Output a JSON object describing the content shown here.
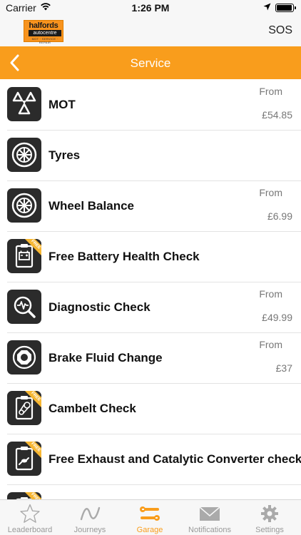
{
  "status": {
    "carrier": "Carrier",
    "time": "1:26 PM"
  },
  "header": {
    "logo": {
      "line1": "halfords",
      "line2": "autocentre",
      "line3": "MOT · SERVICE · REPAIR"
    },
    "sos_label": "SOS"
  },
  "nav": {
    "title": "Service"
  },
  "services": [
    {
      "name": "MOT",
      "icon": "mot-triangles-icon",
      "from": "From",
      "price": "£54.85"
    },
    {
      "name": "Tyres",
      "icon": "tyre-icon"
    },
    {
      "name": "Wheel Balance",
      "icon": "wheel-icon",
      "from": "From",
      "price": "£6.99"
    },
    {
      "name": "Free Battery Health Check",
      "icon": "battery-clipboard-icon",
      "badge": "FREE"
    },
    {
      "name": "Diagnostic Check",
      "icon": "diagnostic-magnifier-icon",
      "from": "From",
      "price": "£49.99"
    },
    {
      "name": "Brake Fluid Change",
      "icon": "brake-icon",
      "from": "From",
      "price": "£37"
    },
    {
      "name": "Cambelt Check",
      "icon": "cambelt-clipboard-icon",
      "badge": "FREE"
    },
    {
      "name": "Free Exhaust and Catalytic Converter check",
      "icon": "exhaust-clipboard-icon",
      "badge": "FREE"
    },
    {
      "name": "",
      "icon": "clipboard-icon",
      "badge": "FREE"
    }
  ],
  "tabs": [
    {
      "label": "Leaderboard",
      "icon": "star-icon"
    },
    {
      "label": "Journeys",
      "icon": "journey-line-icon"
    },
    {
      "label": "Garage",
      "icon": "wrench-icon",
      "active": true
    },
    {
      "label": "Notifications",
      "icon": "envelope-icon"
    },
    {
      "label": "Settings",
      "icon": "gear-icon"
    }
  ],
  "colors": {
    "accent": "#f99d1c",
    "icon_bg": "#2b2b2b",
    "free_badge": "#f7b733"
  }
}
